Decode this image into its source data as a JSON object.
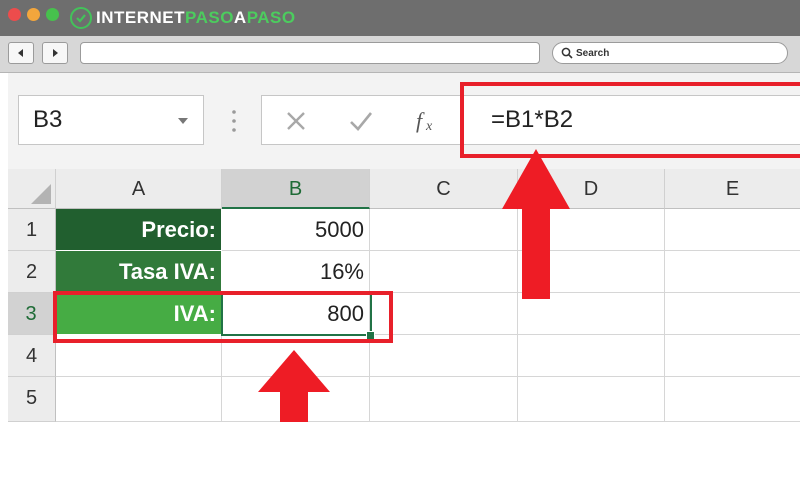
{
  "browser": {
    "logo": {
      "part1": "INTERNET",
      "part2": "PASO",
      "part3": "A",
      "part4": "PASO"
    },
    "search_placeholder": "Search",
    "traffic_lights": [
      "#ed4c4c",
      "#f3a63c",
      "#47c14d"
    ],
    "icons": [
      "back-arrow-icon",
      "forward-arrow-icon",
      "magnifier-icon"
    ]
  },
  "excel": {
    "name_box": "B3",
    "formula": "=B1*B2",
    "columns": [
      "A",
      "B",
      "C",
      "D",
      "E"
    ],
    "selected_column": "B",
    "rows": [
      "1",
      "2",
      "3",
      "4",
      "5"
    ],
    "selected_row": "3",
    "cells": {
      "A1": "Precio:",
      "B1": "5000",
      "A2": "Tasa IVA:",
      "B2": "16%",
      "A3": "IVA:",
      "B3": "800"
    },
    "colors": {
      "label_row_1": "#215f2f",
      "label_row_2": "#317a3a",
      "label_row_3": "#46ac44",
      "excel_green": "#217346",
      "annotation_red": "#e8202a"
    }
  }
}
